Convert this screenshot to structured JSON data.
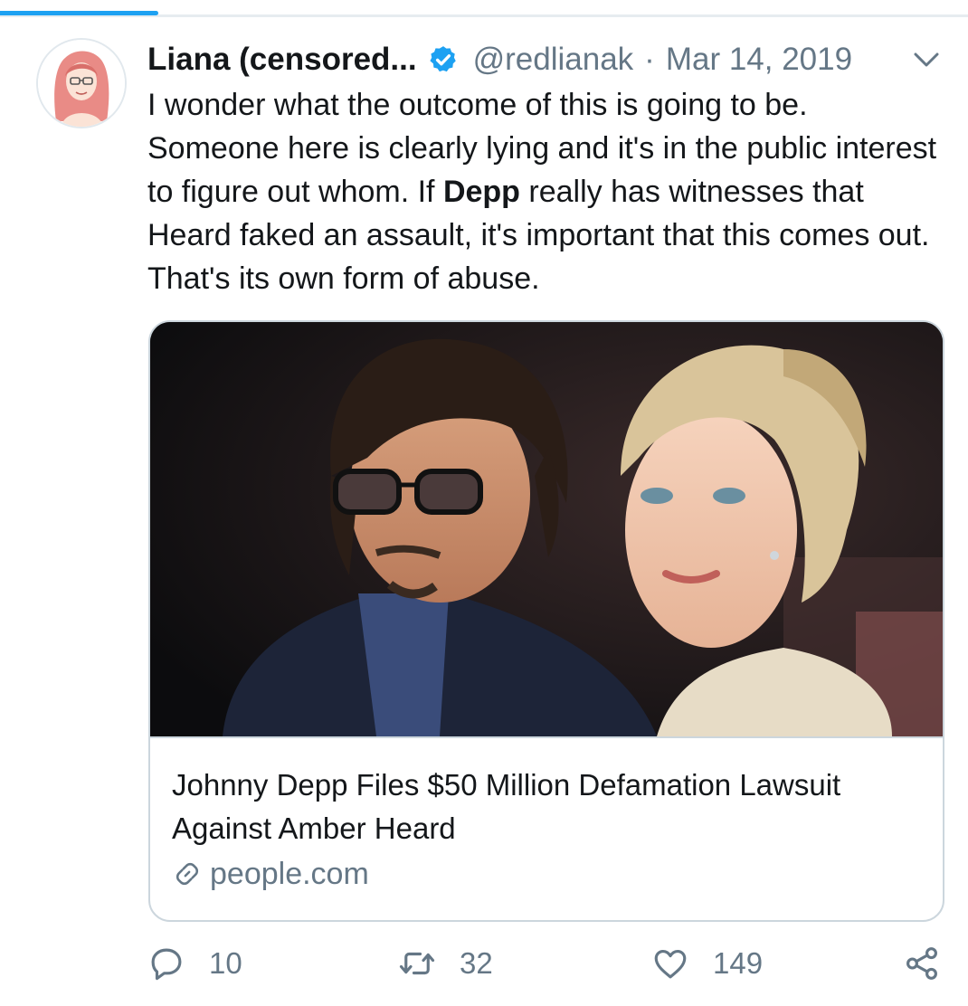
{
  "tweet": {
    "author_name": "Liana (censored...",
    "handle": "@redlianak",
    "separator": "·",
    "date": "Mar 14, 2019",
    "text_part1": "I wonder what the outcome of this is going to be. Someone here is clearly lying and it's in the public interest to figure out whom. If ",
    "text_bold": "Depp",
    "text_part2": " really has witnesses that Heard faked an assault, it's important that this comes out. That's its own form of abuse."
  },
  "card": {
    "title": "Johnny Depp Files $50 Million Defamation Lawsuit Against Amber Heard",
    "domain": "people.com"
  },
  "actions": {
    "replies": "10",
    "retweets": "32",
    "likes": "149"
  },
  "icons": {
    "verified": "verified-badge-icon",
    "menu": "chevron-down-icon",
    "link": "link-icon",
    "reply": "reply-icon",
    "retweet": "retweet-icon",
    "like": "heart-icon",
    "share": "share-icon"
  },
  "colors": {
    "accent": "#1da1f2",
    "secondary_text": "#657786",
    "border": "#ccd6dd"
  }
}
